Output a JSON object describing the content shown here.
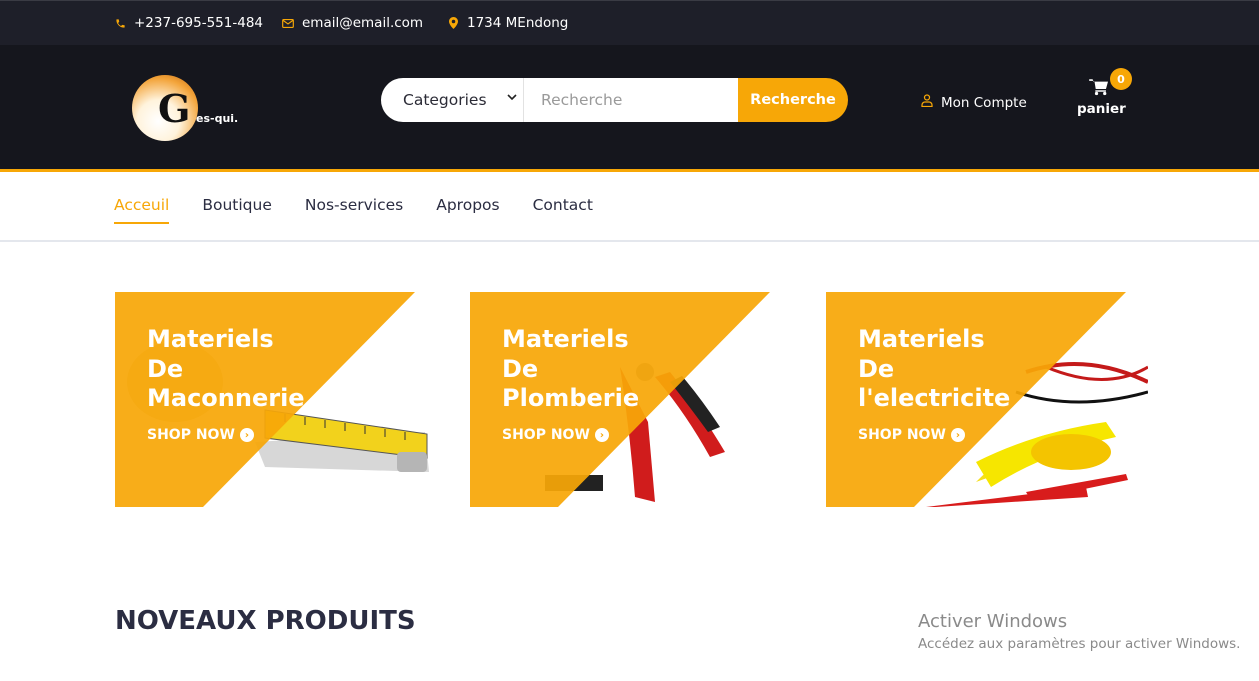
{
  "topbar": {
    "phone": "+237-695-551-484",
    "email": "email@email.com",
    "location": "1734 MEndong"
  },
  "header": {
    "logo_letter": "G",
    "logo_text": "es-qui.",
    "search": {
      "category_label": "Categories",
      "placeholder": "Recherche",
      "button_label": "Recherche"
    },
    "account_label": "Mon Compte",
    "cart": {
      "count": "0",
      "label": "panier"
    }
  },
  "nav": {
    "items": [
      {
        "label": "Acceuil",
        "active": true
      },
      {
        "label": "Boutique"
      },
      {
        "label": "Nos-services"
      },
      {
        "label": "Apropos"
      },
      {
        "label": "Contact"
      }
    ]
  },
  "banners": [
    {
      "title": "Materiels\nDe\nMaconnerie",
      "cta": "SHOP NOW"
    },
    {
      "title": "Materiels\nDe\nPlomberie",
      "cta": "SHOP NOW"
    },
    {
      "title": "Materiels\nDe\nl'electricite",
      "cta": "SHOP NOW"
    }
  ],
  "section_title": "NOVEAUX PRODUITS",
  "watermark": {
    "line1": "Activer Windows",
    "line2": "Accédez aux paramètres pour activer Windows."
  },
  "colors": {
    "accent": "#f7a707",
    "dark": "#15161d",
    "topbar": "#1e1f29"
  }
}
